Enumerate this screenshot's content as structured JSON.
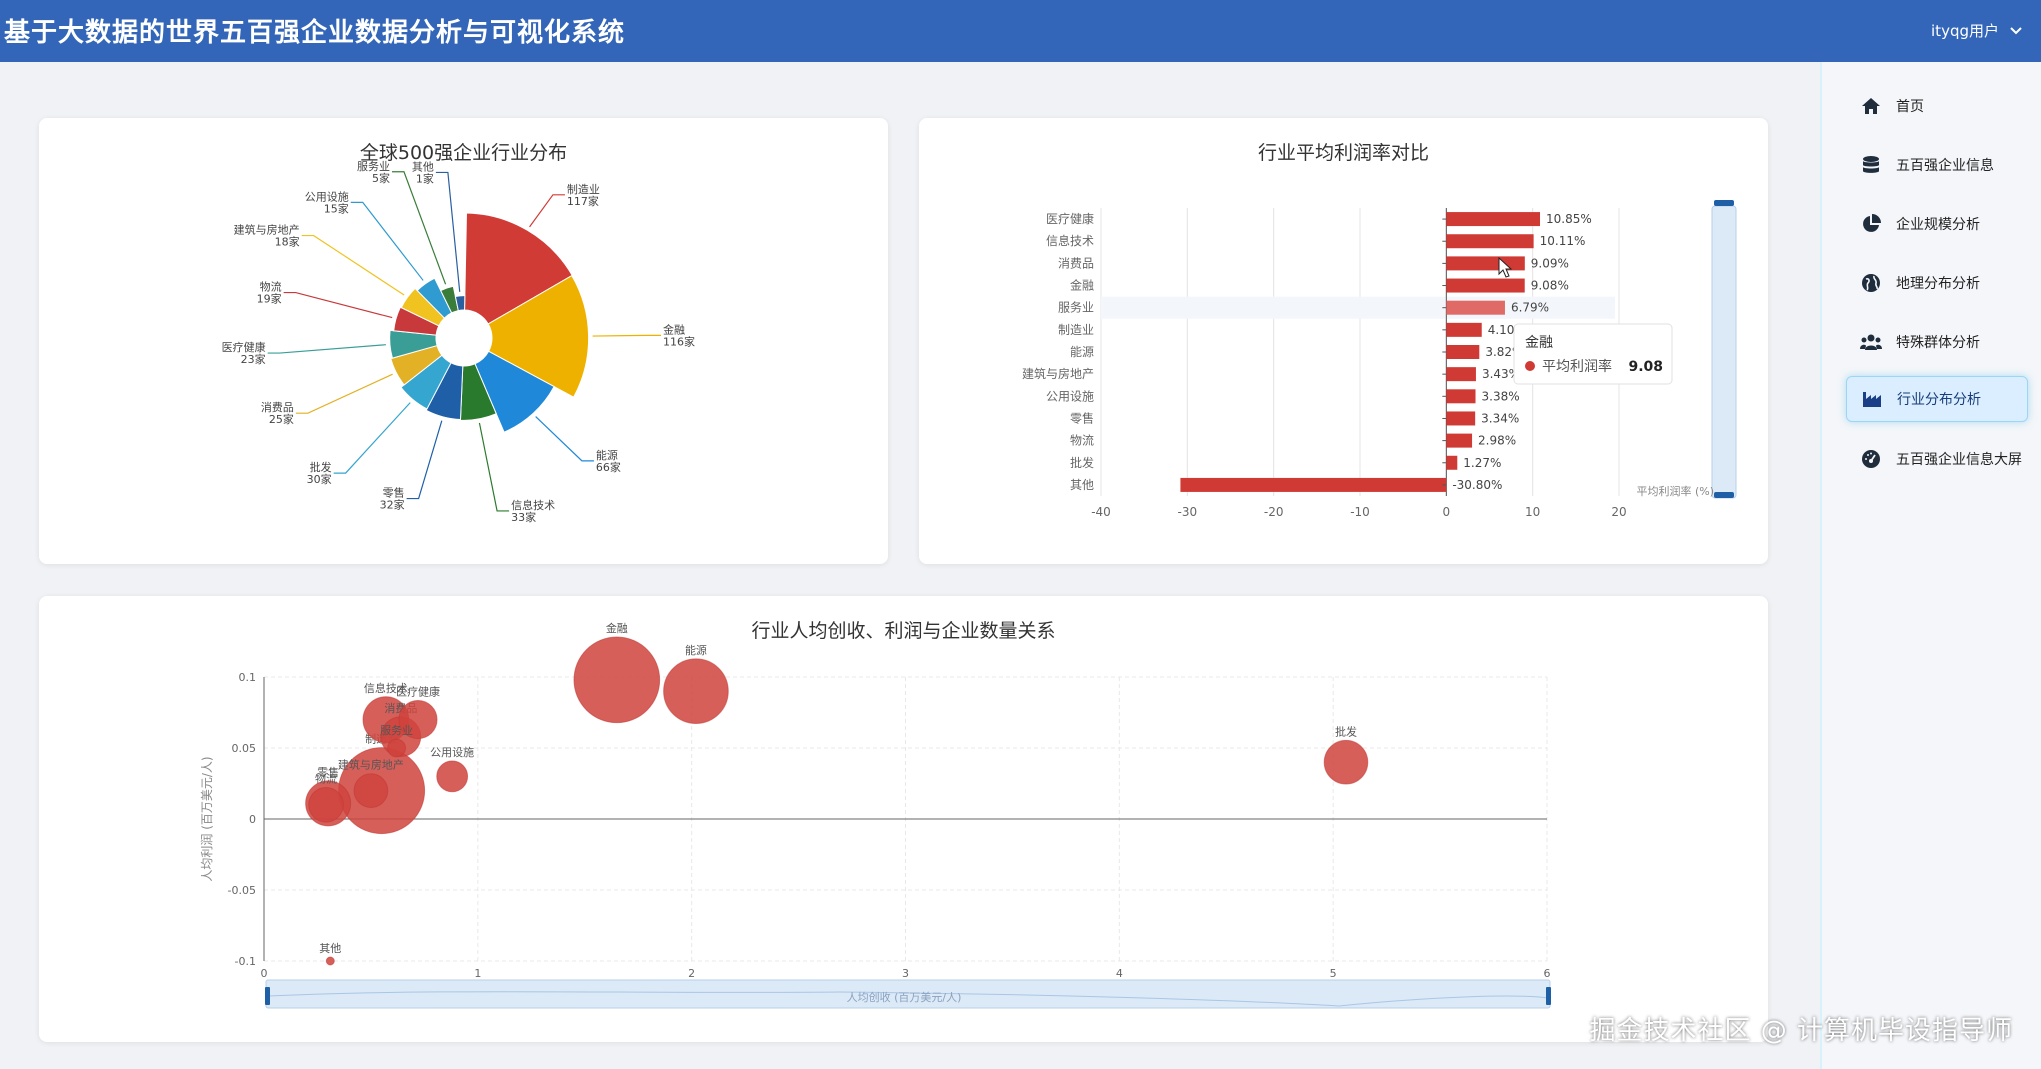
{
  "app": {
    "title": "基于大数据的世界五百强企业数据分析与可视化系统",
    "user": "ityqg用户"
  },
  "sidebar": {
    "items": [
      {
        "label": "首页",
        "icon": "home-icon"
      },
      {
        "label": "五百强企业信息",
        "icon": "database-icon"
      },
      {
        "label": "企业规模分析",
        "icon": "pie-chart-icon"
      },
      {
        "label": "地理分布分析",
        "icon": "globe-icon"
      },
      {
        "label": "特殊群体分析",
        "icon": "users-icon"
      },
      {
        "label": "行业分布分析",
        "icon": "industry-icon",
        "active": true
      },
      {
        "label": "五百强企业信息大屏",
        "icon": "dashboard-icon"
      }
    ]
  },
  "watermark": "掘金技术社区 @ 计算机毕设指导师",
  "charts": {
    "pie": {
      "title": "全球500强企业行业分布",
      "type": "pie",
      "rose": true,
      "unit_suffix": "家",
      "slices": [
        {
          "name": "制造业",
          "value": 117,
          "color": "#d13b35"
        },
        {
          "name": "金融",
          "value": 116,
          "color": "#eeb100"
        },
        {
          "name": "能源",
          "value": 66,
          "color": "#1f88d8"
        },
        {
          "name": "信息技术",
          "value": 33,
          "color": "#2a7a2d"
        },
        {
          "name": "零售",
          "value": 32,
          "color": "#1e5fa8"
        },
        {
          "name": "批发",
          "value": 30,
          "color": "#35a6cf"
        },
        {
          "name": "消费品",
          "value": 25,
          "color": "#e3b125"
        },
        {
          "name": "医疗健康",
          "value": 23,
          "color": "#3a9e97"
        },
        {
          "name": "物流",
          "value": 19,
          "color": "#c8393b"
        },
        {
          "name": "建筑与房地产",
          "value": 18,
          "color": "#f0c320"
        },
        {
          "name": "公用设施",
          "value": 15,
          "color": "#2f9bd0"
        },
        {
          "name": "服务业",
          "value": 5,
          "color": "#3a7d3a"
        },
        {
          "name": "其他",
          "value": 1,
          "color": "#2a5fa0"
        }
      ]
    },
    "bar": {
      "title": "行业平均利润率对比",
      "type": "bar",
      "orientation": "horizontal",
      "categories": [
        "医疗健康",
        "信息技术",
        "消费品",
        "金融",
        "服务业",
        "制造业",
        "能源",
        "建筑与房地产",
        "公用设施",
        "零售",
        "物流",
        "批发",
        "其他"
      ],
      "values": [
        10.85,
        10.11,
        9.09,
        9.08,
        6.79,
        4.1,
        3.82,
        3.43,
        3.38,
        3.34,
        2.98,
        1.27,
        -30.8
      ],
      "value_labels": [
        "10.85%",
        "10.11%",
        "9.09%",
        "9.08%",
        "6.79%",
        "4.10%",
        "3.82%",
        "3.43%",
        "3.38%",
        "3.34%",
        "2.98%",
        "1.27%",
        "-30.80%"
      ],
      "xlim": [
        -40,
        20
      ],
      "xticks": [
        "-40",
        "-30",
        "-20",
        "-10",
        "0",
        "10",
        "20"
      ],
      "color": "#cf3a34",
      "grid": true,
      "datazoom_label": "平均利润率 (%)",
      "tooltip": {
        "category": "金融",
        "series": "平均利润率",
        "value": "9.08"
      }
    },
    "bubble": {
      "title": "行业人均创收、利润与企业数量关系",
      "type": "scatter",
      "xlabel": "人均创收 (百万美元/人)",
      "ylabel": "人均利润 (百万美元/人)",
      "xlim": [
        0,
        6
      ],
      "ylim": [
        -0.1,
        0.1
      ],
      "xticks": [
        "0",
        "1",
        "2",
        "3",
        "4",
        "5",
        "6"
      ],
      "yticks": [
        "0.1",
        "0.05",
        "0",
        "-0.05",
        "-0.1"
      ],
      "color": "#d0433d",
      "grid": true,
      "points": [
        {
          "name": "金融",
          "x": 1.65,
          "y": 0.098,
          "size": 116
        },
        {
          "name": "能源",
          "x": 2.02,
          "y": 0.09,
          "size": 66
        },
        {
          "name": "批发",
          "x": 5.06,
          "y": 0.04,
          "size": 30
        },
        {
          "name": "信息技术",
          "x": 0.57,
          "y": 0.07,
          "size": 33
        },
        {
          "name": "医疗健康",
          "x": 0.72,
          "y": 0.07,
          "size": 23
        },
        {
          "name": "制造业",
          "x": 0.55,
          "y": 0.02,
          "size": 117
        },
        {
          "name": "消费品",
          "x": 0.64,
          "y": 0.058,
          "size": 25
        },
        {
          "name": "服务业",
          "x": 0.62,
          "y": 0.05,
          "size": 5
        },
        {
          "name": "建筑与房地产",
          "x": 0.5,
          "y": 0.02,
          "size": 18
        },
        {
          "name": "公用设施",
          "x": 0.88,
          "y": 0.03,
          "size": 15
        },
        {
          "name": "零售",
          "x": 0.3,
          "y": 0.011,
          "size": 32
        },
        {
          "name": "物流",
          "x": 0.29,
          "y": 0.01,
          "size": 19
        },
        {
          "name": "其他",
          "x": 0.31,
          "y": -0.1,
          "size": 1
        }
      ]
    }
  }
}
